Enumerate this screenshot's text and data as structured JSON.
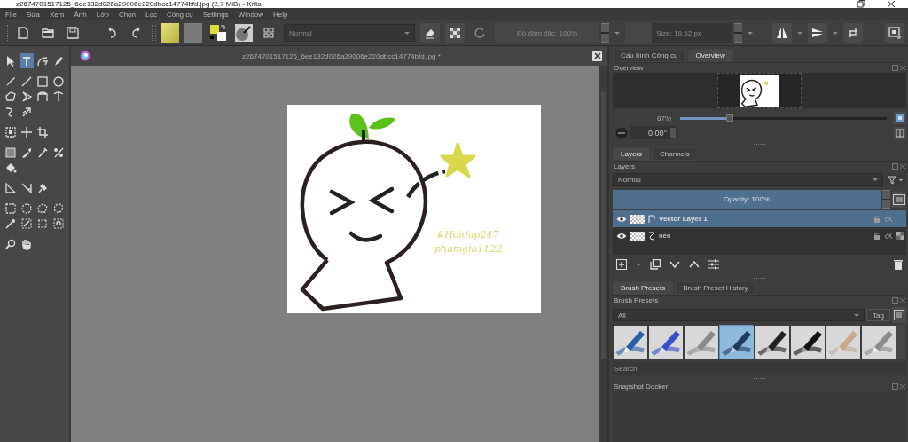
{
  "title_bar": {
    "title": "z2674701517125_6ee132d026a29006e220dbcc14774bfd.jpg (2,7 MiB)  - Krita"
  },
  "menu": [
    "File",
    "Sửa",
    "Xem",
    "Ảnh",
    "Lớp",
    "Chọn",
    "Lọc",
    "Công cụ",
    "Settings",
    "Window",
    "Help"
  ],
  "toolbar": {
    "blend_mode": "Normal",
    "opacity": {
      "text": "Độ đậm đặc: 100%",
      "level": 1
    },
    "size": {
      "text": "Size: 19,52 px",
      "level": 0.25
    }
  },
  "toolbox": {
    "groups": [
      [
        [
          {
            "selected": false
          },
          {
            "selected": true
          },
          {
            "selected": false
          },
          {
            "selected": false
          }
        ]
      ],
      [
        [
          {
            "selected": false
          },
          {
            "selected": false
          },
          {
            "selected": false
          },
          {
            "selected": false
          }
        ],
        [
          {
            "selected": false
          },
          {
            "selected": false
          },
          {
            "selected": false
          },
          {
            "selected": false
          }
        ],
        [
          {
            "selected": false
          },
          {
            "selected": false
          }
        ]
      ],
      [
        [
          {
            "selected": false
          },
          {
            "selected": false
          },
          {
            "selected": false
          }
        ]
      ],
      [
        [
          {
            "selected": false
          },
          {
            "selected": false
          },
          {
            "selected": false
          },
          {
            "selected": false
          }
        ],
        [
          {
            "selected": false
          }
        ]
      ],
      [
        [
          {
            "selected": false
          },
          {
            "selected": false
          },
          {
            "selected": false
          }
        ]
      ],
      [
        [
          {
            "selected": false
          },
          {
            "selected": false
          },
          {
            "selected": false
          },
          {
            "selected": false
          }
        ],
        [
          {
            "selected": false
          },
          {
            "selected": false
          },
          {
            "selected": false
          },
          {
            "selected": false
          }
        ]
      ],
      [
        [
          {
            "selected": false
          },
          {
            "selected": false
          }
        ]
      ]
    ]
  },
  "document_tab": {
    "title": "z2674701517125_6ee132d026a29006e220dbcc14774bfd.jpg *"
  },
  "canvas": {
    "texts": [
      "#Hoidap247",
      "phamgia1122"
    ]
  },
  "overview_docker": {
    "tabs": [
      {
        "label": "Cấu hình Công cụ",
        "selected": false
      },
      {
        "label": "Overview",
        "selected": true
      }
    ],
    "title": "Overview",
    "zoom": {
      "text": "67%",
      "level": 0.24
    },
    "rotation": "0,00°"
  },
  "layers_docker": {
    "tabs": [
      {
        "label": "Layers",
        "selected": true
      },
      {
        "label": "Channels",
        "selected": false
      }
    ],
    "title": "Layers",
    "blend_mode": "Normal",
    "opacity": {
      "text": "Opacity:  100%",
      "level": 1
    },
    "layers": [
      {
        "name": "Vector Layer 1",
        "kind": "vector",
        "visible": true,
        "selected": true
      },
      {
        "name": "nền",
        "kind": "paint",
        "visible": true,
        "selected": false
      }
    ]
  },
  "brush_docker": {
    "tabs": [
      {
        "label": "Brush Presets",
        "selected": true
      },
      {
        "label": "Brush Preset History",
        "selected": false
      }
    ],
    "title": "Brush Presets",
    "tag_filter": "All",
    "tag_button": "Tag",
    "presets": [
      {
        "selected": false
      },
      {
        "selected": false
      },
      {
        "selected": false
      },
      {
        "selected": true
      },
      {
        "selected": false
      },
      {
        "selected": false
      },
      {
        "selected": false
      },
      {
        "selected": false
      }
    ],
    "search": {
      "placeholder": "Search"
    }
  },
  "snapshot_docker": {
    "title": "Snapshot Docker"
  }
}
